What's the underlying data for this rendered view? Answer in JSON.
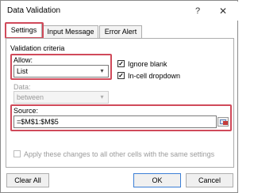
{
  "window": {
    "title": "Data Validation",
    "help_glyph": "?",
    "close_glyph": "✕"
  },
  "tabs": [
    {
      "label": "Settings",
      "active": true
    },
    {
      "label": "Input Message",
      "active": false
    },
    {
      "label": "Error Alert",
      "active": false
    }
  ],
  "settings": {
    "section_title": "Validation criteria",
    "allow": {
      "label": "Allow:",
      "value": "List"
    },
    "ignore_blank": {
      "label": "Ignore blank",
      "checked": true
    },
    "in_cell_dropdown": {
      "label": "In-cell dropdown",
      "checked": true
    },
    "data": {
      "label": "Data:",
      "value": "between",
      "disabled": true
    },
    "source": {
      "label": "Source:",
      "value": "=$M$1:$M$5"
    },
    "apply_all": {
      "label": "Apply these changes to all other cells with the same settings",
      "checked": false,
      "disabled": true
    }
  },
  "buttons": {
    "clear_all": "Clear All",
    "ok": "OK",
    "cancel": "Cancel"
  },
  "glyphs": {
    "check": "✓",
    "dropdown": "▾"
  },
  "colors": {
    "highlight": "#d04a5a",
    "ok_border": "#3c7fd6"
  }
}
